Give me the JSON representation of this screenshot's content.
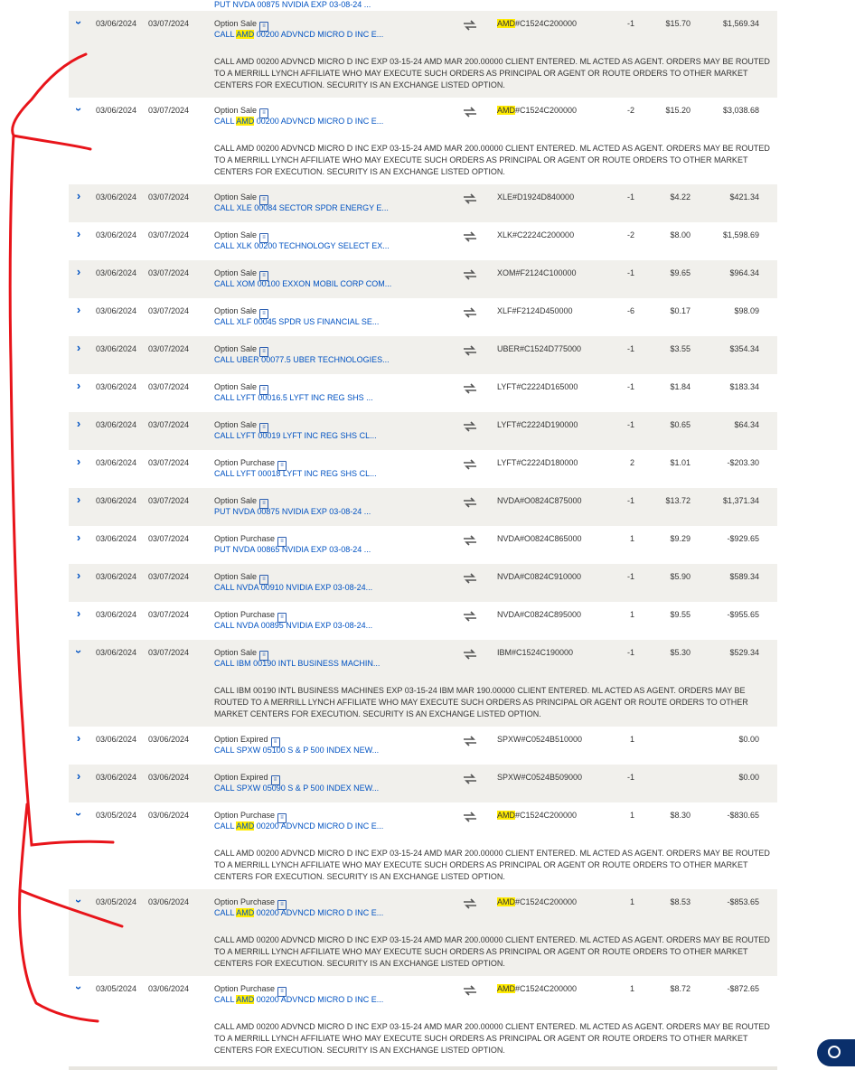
{
  "top_partial": {
    "description": "PUT NVDA 00875 NVIDIA EXP 03-08-24 ..."
  },
  "rows": [
    {
      "expanded": true,
      "trade_date": "03/06/2024",
      "settle_date": "03/07/2024",
      "type": "Option Sale",
      "desc_pre": "CALL ",
      "desc_hl": "AMD",
      "desc_post": " 00200 ADVNCD MICRO D INC E...",
      "sym_hl": "AMD",
      "sym_post": "#C1524C200000",
      "qty": "-1",
      "price": "$15.70",
      "amount": "$1,569.34",
      "detail": "CALL AMD 00200 ADVNCD MICRO D INC EXP 03-15-24 AMD MAR 200.00000 CLIENT ENTERED. ML ACTED AS AGENT. ORDERS MAY BE ROUTED TO A MERRILL LYNCH AFFILIATE WHO MAY EXECUTE SUCH ORDERS AS PRINCIPAL OR AGENT OR ROUTE ORDERS TO OTHER MARKET CENTERS FOR EXECUTION. SECURITY IS AN EXCHANGE LISTED OPTION."
    },
    {
      "expanded": true,
      "trade_date": "03/06/2024",
      "settle_date": "03/07/2024",
      "type": "Option Sale",
      "desc_pre": "CALL ",
      "desc_hl": "AMD",
      "desc_post": " 00200 ADVNCD MICRO D INC E...",
      "sym_hl": "AMD",
      "sym_post": "#C1524C200000",
      "qty": "-2",
      "price": "$15.20",
      "amount": "$3,038.68",
      "detail": "CALL AMD 00200 ADVNCD MICRO D INC EXP 03-15-24 AMD MAR 200.00000 CLIENT ENTERED. ML ACTED AS AGENT. ORDERS MAY BE ROUTED TO A MERRILL LYNCH AFFILIATE WHO MAY EXECUTE SUCH ORDERS AS PRINCIPAL OR AGENT OR ROUTE ORDERS TO OTHER MARKET CENTERS FOR EXECUTION. SECURITY IS AN EXCHANGE LISTED OPTION."
    },
    {
      "expanded": false,
      "trade_date": "03/06/2024",
      "settle_date": "03/07/2024",
      "type": "Option Sale",
      "desc_pre": "CALL XLE 00084 SECTOR SPDR ENERGY E...",
      "desc_hl": "",
      "desc_post": "",
      "sym_hl": "",
      "sym_post": "XLE#D1924D840000",
      "qty": "-1",
      "price": "$4.22",
      "amount": "$421.34",
      "detail": ""
    },
    {
      "expanded": false,
      "trade_date": "03/06/2024",
      "settle_date": "03/07/2024",
      "type": "Option Sale",
      "desc_pre": "CALL XLK 00200 TECHNOLOGY SELECT EX...",
      "desc_hl": "",
      "desc_post": "",
      "sym_hl": "",
      "sym_post": "XLK#C2224C200000",
      "qty": "-2",
      "price": "$8.00",
      "amount": "$1,598.69",
      "detail": ""
    },
    {
      "expanded": false,
      "trade_date": "03/06/2024",
      "settle_date": "03/07/2024",
      "type": "Option Sale",
      "desc_pre": "CALL XOM 00100 EXXON MOBIL CORP COM...",
      "desc_hl": "",
      "desc_post": "",
      "sym_hl": "",
      "sym_post": "XOM#F2124C100000",
      "qty": "-1",
      "price": "$9.65",
      "amount": "$964.34",
      "detail": ""
    },
    {
      "expanded": false,
      "trade_date": "03/06/2024",
      "settle_date": "03/07/2024",
      "type": "Option Sale",
      "desc_pre": "CALL XLF 00045 SPDR US FINANCIAL SE...",
      "desc_hl": "",
      "desc_post": "",
      "sym_hl": "",
      "sym_post": "XLF#F2124D450000",
      "qty": "-6",
      "price": "$0.17",
      "amount": "$98.09",
      "detail": ""
    },
    {
      "expanded": false,
      "trade_date": "03/06/2024",
      "settle_date": "03/07/2024",
      "type": "Option Sale",
      "desc_pre": "CALL UBER 00077.5 UBER TECHNOLOGIES...",
      "desc_hl": "",
      "desc_post": "",
      "sym_hl": "",
      "sym_post": "UBER#C1524D775000",
      "qty": "-1",
      "price": "$3.55",
      "amount": "$354.34",
      "detail": ""
    },
    {
      "expanded": false,
      "trade_date": "03/06/2024",
      "settle_date": "03/07/2024",
      "type": "Option Sale",
      "desc_pre": "CALL LYFT 00016.5 LYFT INC REG SHS ...",
      "desc_hl": "",
      "desc_post": "",
      "sym_hl": "",
      "sym_post": "LYFT#C2224D165000",
      "qty": "-1",
      "price": "$1.84",
      "amount": "$183.34",
      "detail": ""
    },
    {
      "expanded": false,
      "trade_date": "03/06/2024",
      "settle_date": "03/07/2024",
      "type": "Option Sale",
      "desc_pre": "CALL LYFT 00019 LYFT INC REG SHS CL...",
      "desc_hl": "",
      "desc_post": "",
      "sym_hl": "",
      "sym_post": "LYFT#C2224D190000",
      "qty": "-1",
      "price": "$0.65",
      "amount": "$64.34",
      "detail": ""
    },
    {
      "expanded": false,
      "trade_date": "03/06/2024",
      "settle_date": "03/07/2024",
      "type": "Option Purchase",
      "desc_pre": "CALL LYFT 00018 LYFT INC REG SHS CL...",
      "desc_hl": "",
      "desc_post": "",
      "sym_hl": "",
      "sym_post": "LYFT#C2224D180000",
      "qty": "2",
      "price": "$1.01",
      "amount": "-$203.30",
      "detail": ""
    },
    {
      "expanded": false,
      "trade_date": "03/06/2024",
      "settle_date": "03/07/2024",
      "type": "Option Sale",
      "desc_pre": "PUT NVDA 00875 NVIDIA EXP 03-08-24 ...",
      "desc_hl": "",
      "desc_post": "",
      "sym_hl": "",
      "sym_post": "NVDA#O0824C875000",
      "qty": "-1",
      "price": "$13.72",
      "amount": "$1,371.34",
      "detail": ""
    },
    {
      "expanded": false,
      "trade_date": "03/06/2024",
      "settle_date": "03/07/2024",
      "type": "Option Purchase",
      "desc_pre": "PUT NVDA 00865 NVIDIA EXP 03-08-24 ...",
      "desc_hl": "",
      "desc_post": "",
      "sym_hl": "",
      "sym_post": "NVDA#O0824C865000",
      "qty": "1",
      "price": "$9.29",
      "amount": "-$929.65",
      "detail": ""
    },
    {
      "expanded": false,
      "trade_date": "03/06/2024",
      "settle_date": "03/07/2024",
      "type": "Option Sale",
      "desc_pre": "CALL NVDA 00910 NVIDIA EXP 03-08-24...",
      "desc_hl": "",
      "desc_post": "",
      "sym_hl": "",
      "sym_post": "NVDA#C0824C910000",
      "qty": "-1",
      "price": "$5.90",
      "amount": "$589.34",
      "detail": ""
    },
    {
      "expanded": false,
      "trade_date": "03/06/2024",
      "settle_date": "03/07/2024",
      "type": "Option Purchase",
      "desc_pre": "CALL NVDA 00895 NVIDIA EXP 03-08-24...",
      "desc_hl": "",
      "desc_post": "",
      "sym_hl": "",
      "sym_post": "NVDA#C0824C895000",
      "qty": "1",
      "price": "$9.55",
      "amount": "-$955.65",
      "detail": ""
    },
    {
      "expanded": true,
      "trade_date": "03/06/2024",
      "settle_date": "03/07/2024",
      "type": "Option Sale",
      "desc_pre": "CALL IBM 00190 INTL BUSINESS MACHIN...",
      "desc_hl": "",
      "desc_post": "",
      "sym_hl": "",
      "sym_post": "IBM#C1524C190000",
      "qty": "-1",
      "price": "$5.30",
      "amount": "$529.34",
      "detail": "CALL IBM 00190 INTL BUSINESS MACHINES EXP 03-15-24 IBM MAR 190.00000 CLIENT ENTERED. ML ACTED AS AGENT. ORDERS MAY BE ROUTED TO A MERRILL LYNCH AFFILIATE WHO MAY EXECUTE SUCH ORDERS AS PRINCIPAL OR AGENT OR ROUTE ORDERS TO OTHER MARKET CENTERS FOR EXECUTION. SECURITY IS AN EXCHANGE LISTED OPTION."
    },
    {
      "expanded": false,
      "trade_date": "03/06/2024",
      "settle_date": "03/06/2024",
      "type": "Option Expired",
      "desc_pre": "CALL SPXW 05100 S & P 500 INDEX NEW...",
      "desc_hl": "",
      "desc_post": "",
      "sym_hl": "",
      "sym_post": "SPXW#C0524B510000",
      "qty": "1",
      "price": "",
      "amount": "$0.00",
      "detail": ""
    },
    {
      "expanded": false,
      "trade_date": "03/06/2024",
      "settle_date": "03/06/2024",
      "type": "Option Expired",
      "desc_pre": "CALL SPXW 05090 S & P 500 INDEX NEW...",
      "desc_hl": "",
      "desc_post": "",
      "sym_hl": "",
      "sym_post": "SPXW#C0524B509000",
      "qty": "-1",
      "price": "",
      "amount": "$0.00",
      "detail": ""
    },
    {
      "expanded": true,
      "trade_date": "03/05/2024",
      "settle_date": "03/06/2024",
      "type": "Option Purchase",
      "desc_pre": "CALL ",
      "desc_hl": "AMD",
      "desc_post": " 00200 ADVNCD MICRO D INC E...",
      "sym_hl": "AMD",
      "sym_post": "#C1524C200000",
      "qty": "1",
      "price": "$8.30",
      "amount": "-$830.65",
      "detail": "CALL AMD 00200 ADVNCD MICRO D INC EXP 03-15-24 AMD MAR 200.00000 CLIENT ENTERED. ML ACTED AS AGENT. ORDERS MAY BE ROUTED TO A MERRILL LYNCH AFFILIATE WHO MAY EXECUTE SUCH ORDERS AS PRINCIPAL OR AGENT OR ROUTE ORDERS TO OTHER MARKET CENTERS FOR EXECUTION. SECURITY IS AN EXCHANGE LISTED OPTION."
    },
    {
      "expanded": true,
      "trade_date": "03/05/2024",
      "settle_date": "03/06/2024",
      "type": "Option Purchase",
      "desc_pre": "CALL ",
      "desc_hl": "AMD",
      "desc_post": " 00200 ADVNCD MICRO D INC E...",
      "sym_hl": "AMD",
      "sym_post": "#C1524C200000",
      "qty": "1",
      "price": "$8.53",
      "amount": "-$853.65",
      "detail": "CALL AMD 00200 ADVNCD MICRO D INC EXP 03-15-24 AMD MAR 200.00000 CLIENT ENTERED. ML ACTED AS AGENT. ORDERS MAY BE ROUTED TO A MERRILL LYNCH AFFILIATE WHO MAY EXECUTE SUCH ORDERS AS PRINCIPAL OR AGENT OR ROUTE ORDERS TO OTHER MARKET CENTERS FOR EXECUTION. SECURITY IS AN EXCHANGE LISTED OPTION."
    },
    {
      "expanded": true,
      "trade_date": "03/05/2024",
      "settle_date": "03/06/2024",
      "type": "Option Purchase",
      "desc_pre": "CALL ",
      "desc_hl": "AMD",
      "desc_post": " 00200 ADVNCD MICRO D INC E...",
      "sym_hl": "AMD",
      "sym_post": "#C1524C200000",
      "qty": "1",
      "price": "$8.72",
      "amount": "-$872.65",
      "detail": "CALL AMD 00200 ADVNCD MICRO D INC EXP 03-15-24 AMD MAR 200.00000 CLIENT ENTERED. ML ACTED AS AGENT. ORDERS MAY BE ROUTED TO A MERRILL LYNCH AFFILIATE WHO MAY EXECUTE SUCH ORDERS AS PRINCIPAL OR AGENT OR ROUTE ORDERS TO OTHER MARKET CENTERS FOR EXECUTION. SECURITY IS AN EXCHANGE LISTED OPTION."
    }
  ],
  "colors": {
    "link": "#0052c2",
    "highlight": "#ffeb00",
    "row_shade": "#f1f0ec",
    "annotation": "#e8141a",
    "chat_button": "#0a2f6b"
  },
  "icons": {
    "expand": "chevron-right-icon",
    "collapse": "chevron-down-icon",
    "receipt": "receipt-icon",
    "transfer": "transfer-arrows-icon",
    "chat": "chat-bubble-icon"
  }
}
